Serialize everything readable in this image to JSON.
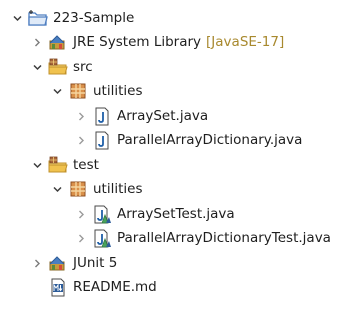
{
  "tree": {
    "project": {
      "label": "223-Sample"
    },
    "jre": {
      "label": "JRE System Library",
      "decoration": "[JavaSE-17]"
    },
    "src": {
      "label": "src"
    },
    "src_pkg": {
      "label": "utilities"
    },
    "src_file1": {
      "label": "ArraySet.java"
    },
    "src_file2": {
      "label": "ParallelArrayDictionary.java"
    },
    "test": {
      "label": "test"
    },
    "test_pkg": {
      "label": "utilities"
    },
    "test_file1": {
      "label": "ArraySetTest.java"
    },
    "test_file2": {
      "label": "ParallelArrayDictionaryTest.java"
    },
    "junit": {
      "label": "JUnit 5"
    },
    "readme": {
      "label": "README.md"
    }
  },
  "icons": {
    "project": "project-folder-icon",
    "library": "library-icon",
    "source_folder": "source-folder-icon",
    "package": "package-icon",
    "java_file": "java-file-icon",
    "test_file": "junit-test-file-icon",
    "markdown_file": "markdown-file-icon",
    "expanded": "chevron-down-icon",
    "collapsed": "chevron-right-icon"
  },
  "colors": {
    "decoration": "#a8892e",
    "folder": "#e9b94e",
    "package": "#b8743a",
    "java_blue": "#1f5fa8",
    "junit_green": "#49a35c"
  }
}
